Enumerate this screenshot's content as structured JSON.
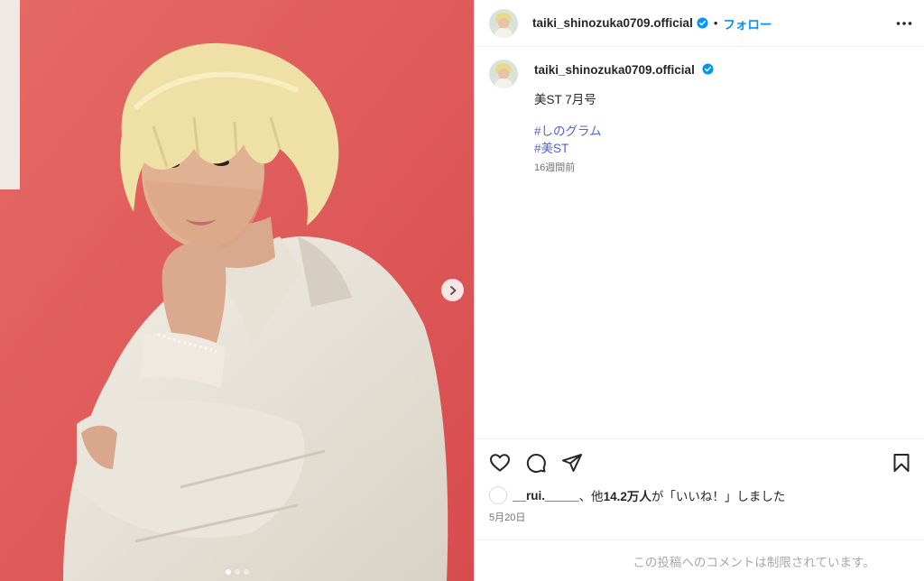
{
  "post": {
    "username": "taiki_shinozuka0709.official",
    "separator": "•",
    "follow_label": "フォロー",
    "caption_text": "美ST 7月号",
    "hashtags": [
      "#しのグラム",
      "#美ST"
    ],
    "caption_time": "16週間前",
    "likes": {
      "first_user": "__rui._____",
      "middle": "、他",
      "count": "14.2万人",
      "suffix": "が「いいね！」しました"
    },
    "date": "5月20日",
    "comments_disabled": "この投稿へのコメントは制限されています。"
  },
  "media": {
    "carousel_total": 3,
    "carousel_active": 0,
    "background_color": "#e35b5b"
  },
  "icons": {
    "like": "heart-icon",
    "comment": "comment-bubble-icon",
    "share": "paper-plane-icon",
    "save": "bookmark-icon",
    "more": "more-options-icon",
    "next": "chevron-right-icon",
    "verified": "verified-badge-icon"
  },
  "colors": {
    "accent": "#0095f6",
    "hashtag": "#4f63c9",
    "muted": "#737373"
  }
}
